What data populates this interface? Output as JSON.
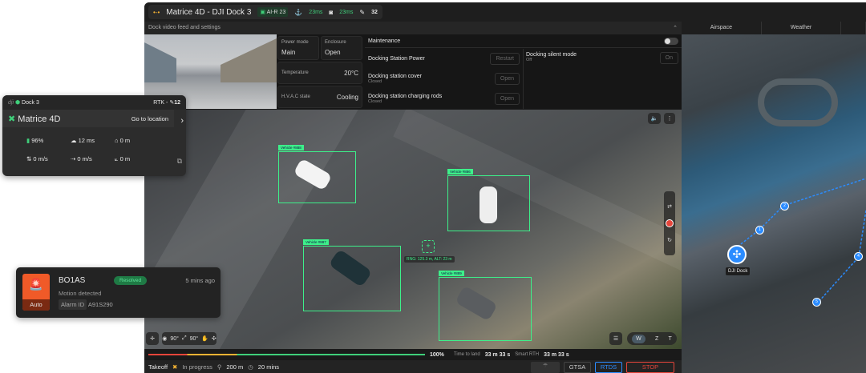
{
  "header": {
    "title": "Matrice 4D - DJI Dock 3",
    "ai_badge": "AI-R 23",
    "latency_1": "23ms",
    "latency_2": "23ms",
    "satellites": "32"
  },
  "dock_panel": {
    "title": "Dock video feed and settings",
    "power_mode": {
      "label": "Power mode",
      "value": "Main"
    },
    "enclosure": {
      "label": "Enclosure",
      "value": "Open"
    },
    "temperature": {
      "label": "Temperature",
      "value": "20°C"
    },
    "hvac": {
      "label": "H.V.A.C state",
      "value": "Cooling"
    },
    "maintenance": "Maintenance",
    "station_power": {
      "label": "Docking Station Power",
      "button": "Restart"
    },
    "silent_mode": {
      "label": "Docking silent mode",
      "status": "Off",
      "button": "On"
    },
    "station_cover": {
      "label": "Docking station cover",
      "status": "Closed",
      "button": "Open"
    },
    "charging_rods": {
      "label": "Docking station charging rods",
      "status": "Closed",
      "button": "Open"
    }
  },
  "video": {
    "detections": [
      "Vehicle #888",
      "Vehicle #886",
      "Vehicle #887",
      "Vehicle #889"
    ],
    "target_readout": "RNG: 125.3 m, ALT: 23 m",
    "gimbal_pitch": "90°",
    "gimbal_yaw": "90°",
    "zoom_modes": [
      "W",
      "Z",
      "T"
    ]
  },
  "progress": {
    "percent_label": "100%",
    "percent": 100,
    "time_to_land_label": "Time to land",
    "time_to_land": "33 m 33 s",
    "smart_rth_label": "Smart RTH",
    "smart_rth": "33 m 33 s"
  },
  "status_bar": {
    "phase": "Takeoff",
    "state": "In progress",
    "altitude": "200 m",
    "duration": "20 mins",
    "buttons": [
      "GTSA",
      "RTDS",
      "STOP"
    ]
  },
  "map": {
    "tabs": [
      "Airspace",
      "Weather"
    ],
    "dock_label": "DJI Dock",
    "waypoints": [
      "1",
      "2",
      "4",
      "5"
    ]
  },
  "drone_card": {
    "dock": "Dock 3",
    "rtk": "RTK -",
    "satellites": "12",
    "drone": "Matrice 4D",
    "go_to": "Go to location",
    "battery": "96%",
    "latency": "12 ms",
    "home_dist": "0 m",
    "vspeed": "0 m/s",
    "hspeed": "0 m/s",
    "height": "0 m"
  },
  "alarm": {
    "title": "BO1AS",
    "status": "Resolved",
    "time": "5 mins ago",
    "description": "Motion detected",
    "id_label": "Alarm ID",
    "id": "A91S290",
    "mode": "Auto"
  },
  "colors": {
    "accent_green": "#3fcf7a",
    "stop_red": "#e6453a",
    "rtds_blue": "#2b8cff",
    "alarm_orange": "#f05a28"
  }
}
